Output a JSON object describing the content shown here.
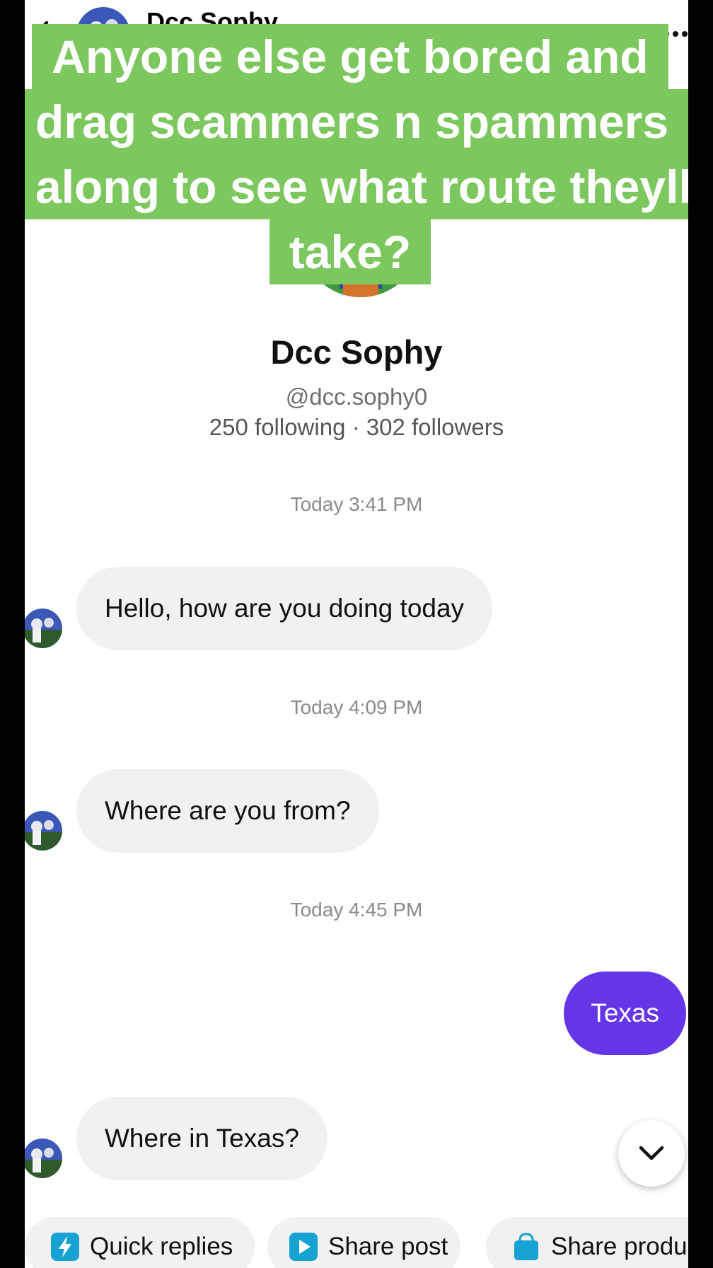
{
  "header": {
    "name": "Dcc Sophy",
    "back_icon": "chevron-left-icon",
    "more_icon": "more-dots-icon"
  },
  "caption": {
    "lines": [
      "Anyone else get bored and",
      "drag scammers n spammers",
      "along to see what route theyll",
      "take?"
    ],
    "background_color": "#7cc75e"
  },
  "profile": {
    "name": "Dcc Sophy",
    "handle": "@dcc.sophy0",
    "stats": "250 following · 302 followers"
  },
  "conversation": {
    "timestamps": [
      "Today 3:41 PM",
      "Today 4:09 PM",
      "Today 4:45 PM"
    ],
    "messages": [
      {
        "from": "them",
        "text": "Hello, how are you doing today"
      },
      {
        "from": "them",
        "text": "Where are you from?"
      },
      {
        "from": "me",
        "text": "Texas"
      },
      {
        "from": "them",
        "text": "Where in Texas?"
      }
    ],
    "outgoing_bubble_color": "#6535e8",
    "incoming_bubble_color": "#f1f1f2"
  },
  "scroll_down_icon": "chevron-down-icon",
  "quick_actions": [
    {
      "label": "Quick replies",
      "icon": "lightning-icon",
      "color": "#16a3d3"
    },
    {
      "label": "Share post",
      "icon": "play-icon",
      "color": "#16a3d3"
    },
    {
      "label": "Share produ",
      "icon": "shopping-bag-icon",
      "color": "#16a3d3"
    }
  ]
}
